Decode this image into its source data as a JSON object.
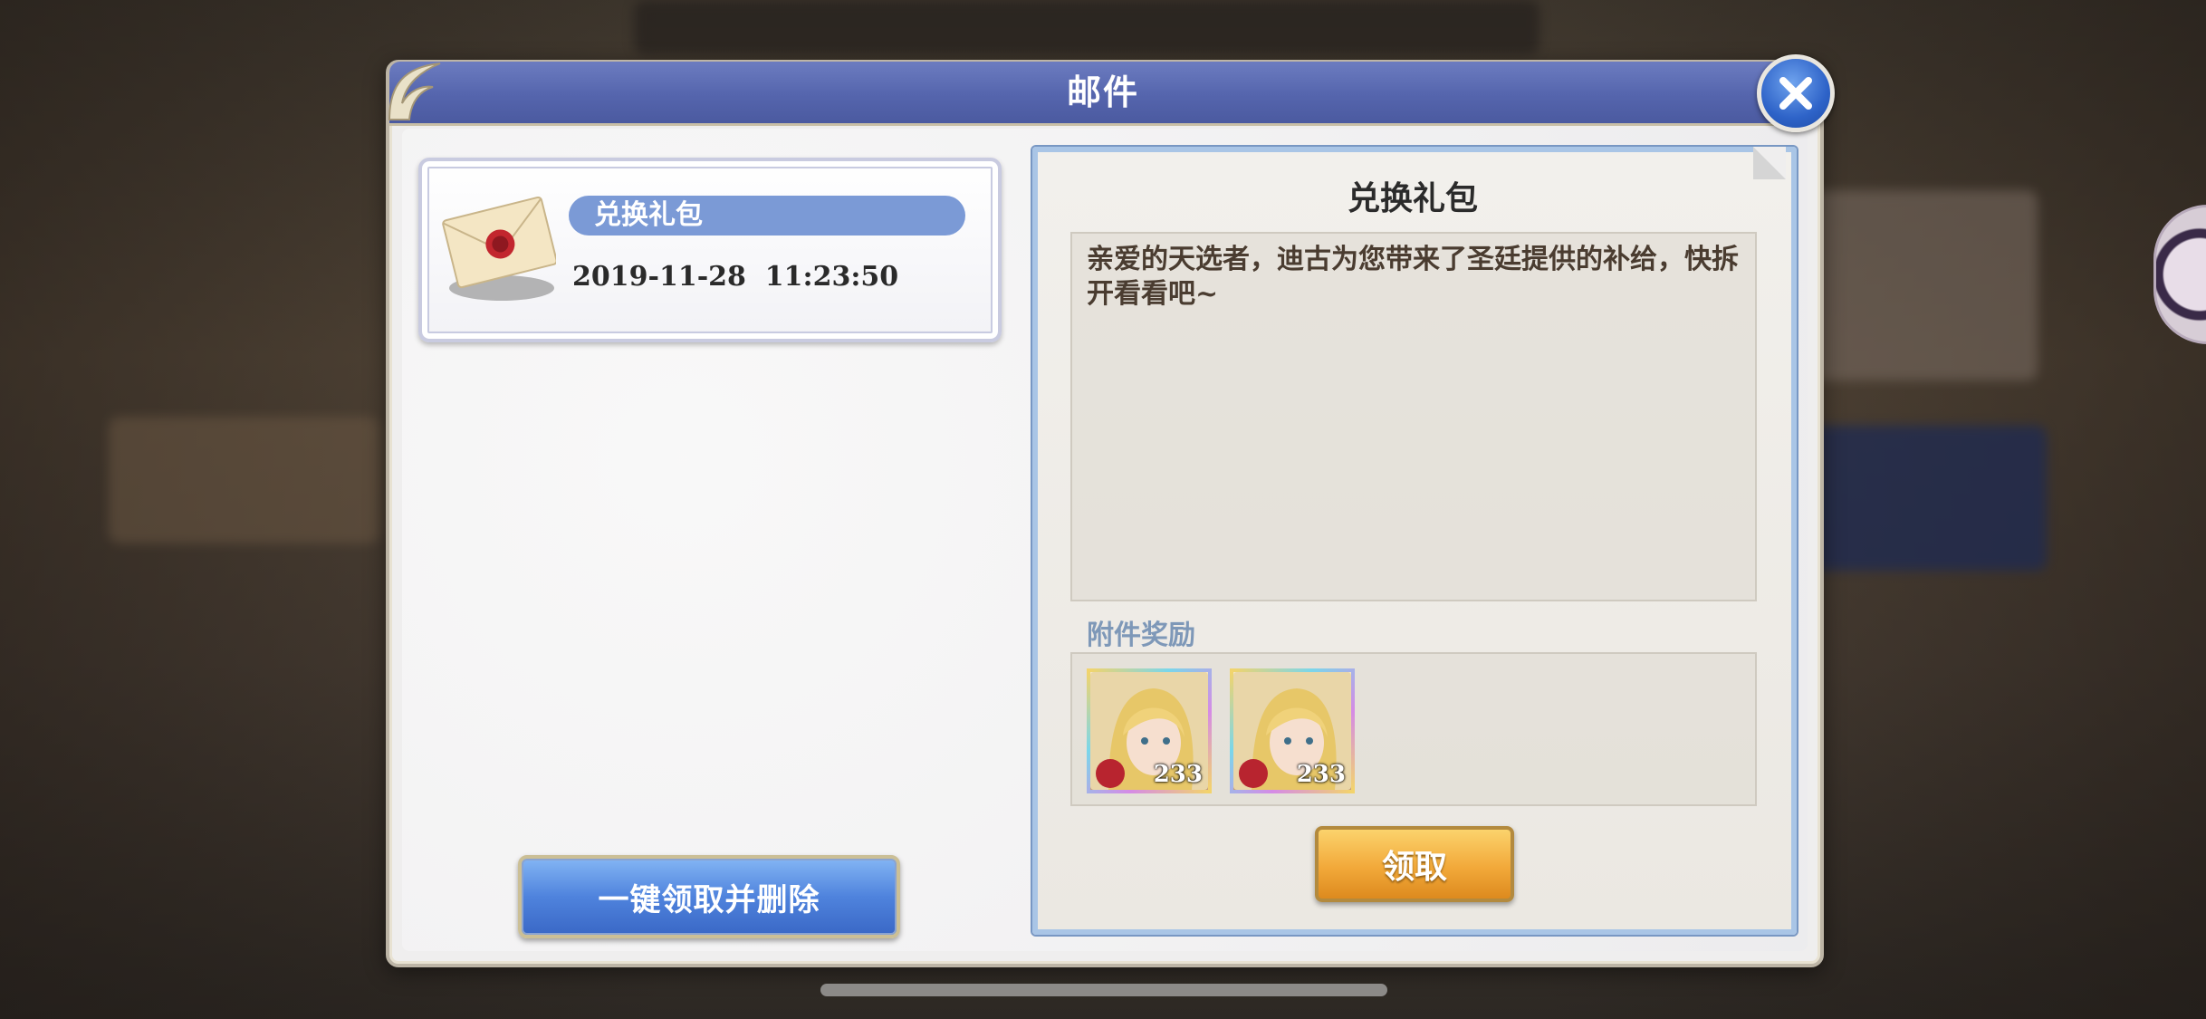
{
  "dialog": {
    "title": "邮件",
    "close_icon": "close-icon"
  },
  "mail_list": {
    "items": [
      {
        "icon": "envelope-icon",
        "name": "兑换礼包",
        "date": "2019-11-28  11:23:50"
      }
    ],
    "claim_all_label": "一键领取并删除"
  },
  "detail": {
    "title": "兑换礼包",
    "message": "亲爱的天选者，迪古为您带来了圣廷提供的补给，快拆开看看吧~",
    "rewards_label": "附件奖励",
    "rewards": [
      {
        "icon": "character-portrait-icon",
        "count": "233"
      },
      {
        "icon": "character-portrait-icon",
        "count": "233"
      }
    ],
    "claim_label": "领取"
  },
  "colors": {
    "title_bar": "#5565ad",
    "mail_name_bar": "#7b9ad6",
    "claim_button": "#f2a93a",
    "claim_all_button": "#4f83dd",
    "close_button": "#2e63c8"
  }
}
